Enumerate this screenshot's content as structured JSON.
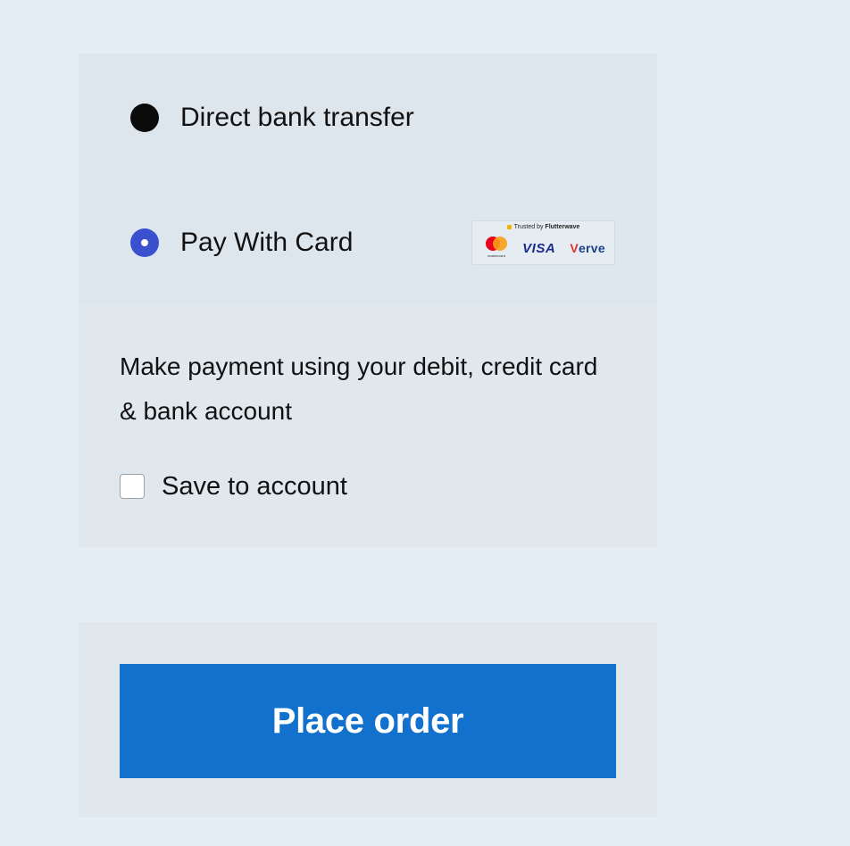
{
  "payment_methods": [
    {
      "label": "Direct bank transfer",
      "selected": false
    },
    {
      "label": "Pay With Card",
      "selected": true
    }
  ],
  "badge": {
    "trusted_prefix": "Trusted by",
    "trusted_brand": "Flutterwave",
    "mastercard_text": "mastercard",
    "visa_text": "VISA",
    "verve_v": "V",
    "verve_rest": "erve"
  },
  "card_description": "Make payment using your debit, credit card & bank account",
  "save_to_account": {
    "label": "Save to account",
    "checked": false
  },
  "place_order_label": "Place order",
  "colors": {
    "page_bg": "#e5eef5",
    "selected_radio": "#3a50cf",
    "button_bg": "#1271cd"
  }
}
